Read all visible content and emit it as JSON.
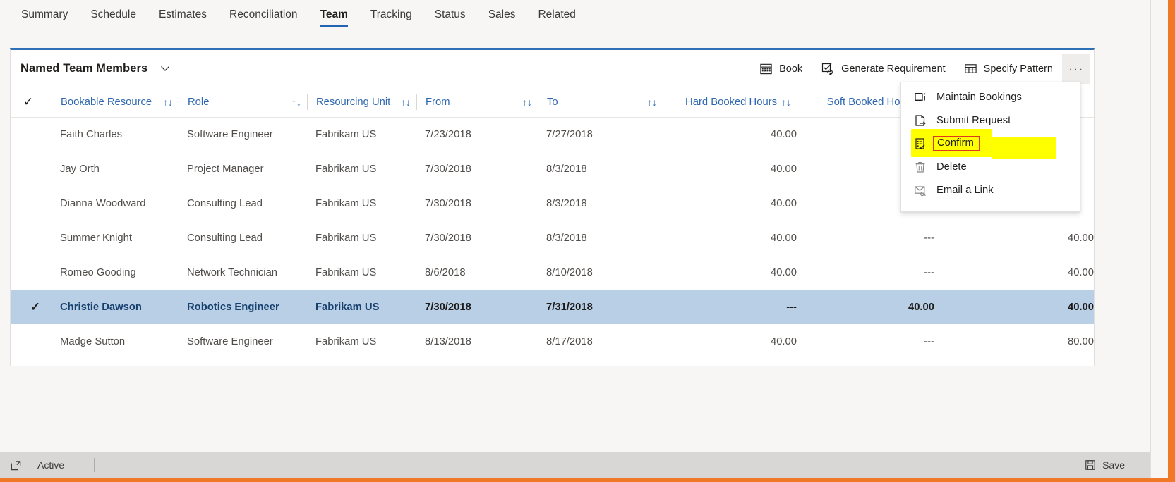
{
  "tabs": [
    {
      "label": "Summary",
      "active": false
    },
    {
      "label": "Schedule",
      "active": false
    },
    {
      "label": "Estimates",
      "active": false
    },
    {
      "label": "Reconciliation",
      "active": false
    },
    {
      "label": "Team",
      "active": true
    },
    {
      "label": "Tracking",
      "active": false
    },
    {
      "label": "Status",
      "active": false
    },
    {
      "label": "Sales",
      "active": false
    },
    {
      "label": "Related",
      "active": false
    }
  ],
  "panel": {
    "title": "Named Team Members",
    "commands": [
      {
        "label": "Book",
        "icon": "calendar-icon"
      },
      {
        "label": "Generate Requirement",
        "icon": "checkbox-refresh-icon"
      },
      {
        "label": "Specify Pattern",
        "icon": "table-grid-icon"
      }
    ],
    "overflow_label": "···"
  },
  "overflow_menu": {
    "items": [
      {
        "label": "Maintain Bookings",
        "icon": "maintain-bookings-icon",
        "highlighted": false
      },
      {
        "label": "Submit Request",
        "icon": "submit-request-icon",
        "highlighted": false
      },
      {
        "label": "Confirm",
        "icon": "confirm-clipboard-icon",
        "highlighted": true
      },
      {
        "label": "Delete",
        "icon": "trash-icon",
        "highlighted": false
      },
      {
        "label": "Email a Link",
        "icon": "email-link-icon",
        "highlighted": false
      }
    ],
    "highlight_color": "#ffff00",
    "annotation_box_color": "#e03a1e"
  },
  "table": {
    "columns": [
      {
        "label": "Bookable Resource",
        "sortable": true,
        "align": "left"
      },
      {
        "label": "Role",
        "sortable": true,
        "align": "left"
      },
      {
        "label": "Resourcing Unit",
        "sortable": true,
        "align": "left"
      },
      {
        "label": "From",
        "sortable": true,
        "align": "left"
      },
      {
        "label": "To",
        "sortable": true,
        "align": "left"
      },
      {
        "label": "Hard Booked Hours",
        "sortable": true,
        "align": "right"
      },
      {
        "label": "Soft Booked Hours",
        "sortable": true,
        "align": "right"
      },
      {
        "label": "",
        "sortable": false,
        "align": "right"
      }
    ],
    "sort_glyph": "↑↓",
    "select_all_glyph": "✓",
    "rows": [
      {
        "selected": false,
        "resource": "Faith Charles",
        "role": "Software Engineer",
        "unit": "Fabrikam US",
        "from": "7/23/2018",
        "to": "7/27/2018",
        "hard": "40.00",
        "soft": "",
        "total": ""
      },
      {
        "selected": false,
        "resource": "Jay Orth",
        "role": "Project Manager",
        "unit": "Fabrikam US",
        "from": "7/30/2018",
        "to": "8/3/2018",
        "hard": "40.00",
        "soft": "",
        "total": ""
      },
      {
        "selected": false,
        "resource": "Dianna Woodward",
        "role": "Consulting Lead",
        "unit": "Fabrikam US",
        "from": "7/30/2018",
        "to": "8/3/2018",
        "hard": "40.00",
        "soft": "",
        "total": ""
      },
      {
        "selected": false,
        "resource": "Summer Knight",
        "role": "Consulting Lead",
        "unit": "Fabrikam US",
        "from": "7/30/2018",
        "to": "8/3/2018",
        "hard": "40.00",
        "soft": "---",
        "total": "40.00"
      },
      {
        "selected": false,
        "resource": "Romeo Gooding",
        "role": "Network Technician",
        "unit": "Fabrikam US",
        "from": "8/6/2018",
        "to": "8/10/2018",
        "hard": "40.00",
        "soft": "---",
        "total": "40.00"
      },
      {
        "selected": true,
        "resource": "Christie Dawson",
        "role": "Robotics Engineer",
        "unit": "Fabrikam US",
        "from": "7/30/2018",
        "to": "7/31/2018",
        "hard": "---",
        "soft": "40.00",
        "total": "40.00"
      },
      {
        "selected": false,
        "resource": "Madge Sutton",
        "role": "Software Engineer",
        "unit": "Fabrikam US",
        "from": "8/13/2018",
        "to": "8/17/2018",
        "hard": "40.00",
        "soft": "---",
        "total": "80.00"
      }
    ]
  },
  "statusbar": {
    "state_label": "Active",
    "save_label": "Save"
  },
  "colors": {
    "accent_blue": "#2f68b1",
    "tab_underline": "#2266b3",
    "selected_row": "#b9cfe6",
    "alt_row": "#f1f0ef",
    "page_bg": "#f7f6f4",
    "frame_orange": "#f07828"
  }
}
